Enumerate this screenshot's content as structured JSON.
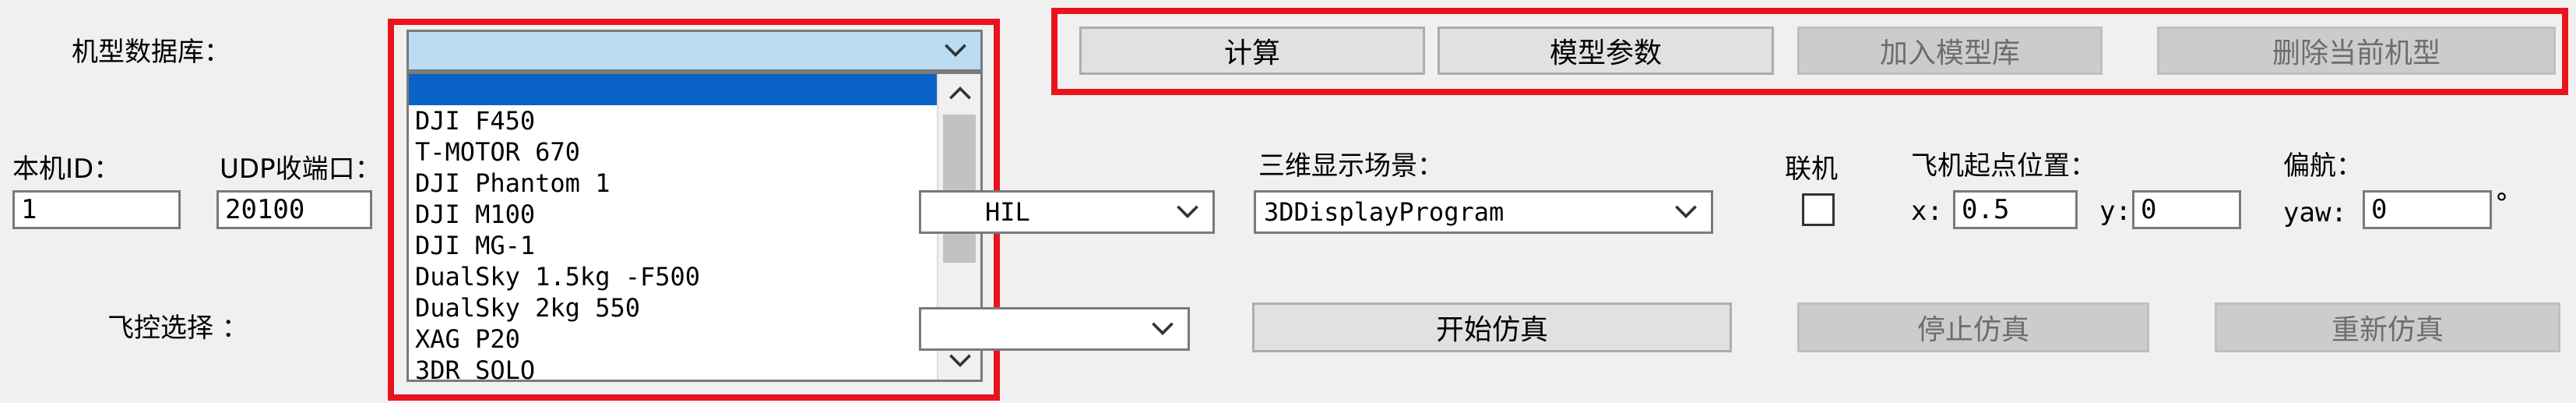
{
  "model_db": {
    "label": "机型数据库：",
    "selected_value": "",
    "options": [
      "",
      "DJI F450",
      "T-MOTOR 670",
      "DJI Phantom 1",
      "DJI M100",
      "DJI MG-1",
      "DualSky 1.5kg -F500",
      "DualSky 2kg 550",
      "XAG P20",
      "3DR SOLO"
    ]
  },
  "buttons": {
    "calc": "计算",
    "model_params": "模型参数",
    "add_model": "加入模型库",
    "delete_model": "删除当前机型",
    "start_sim": "开始仿真",
    "stop_sim": "停止仿真",
    "restart_sim": "重新仿真"
  },
  "local_id": {
    "label": "本机ID：",
    "value": "1"
  },
  "udp_port": {
    "label": "UDP收端口：",
    "value": "20100"
  },
  "sim_mode": {
    "visible_value": "HIL"
  },
  "scene3d": {
    "label": "三维显示场景：",
    "value": "3DDisplayProgram"
  },
  "online": {
    "label": "联机",
    "checked": false
  },
  "start_pos": {
    "label": "飞机起点位置：",
    "x_label": "x:",
    "x_value": "0.5",
    "y_label": "y:",
    "y_value": "0"
  },
  "yaw": {
    "label": "偏航：",
    "yaw_label": "yaw:",
    "value": "0",
    "unit": "°"
  },
  "flight_ctrl": {
    "label": "飞控选择 ："
  },
  "colors": {
    "highlight_red": "#e8131b",
    "selection_blue": "#0a64c8",
    "combo_blue": "#bcdcf4"
  },
  "icons": [
    "chevron-down-icon",
    "chevron-up-icon"
  ]
}
